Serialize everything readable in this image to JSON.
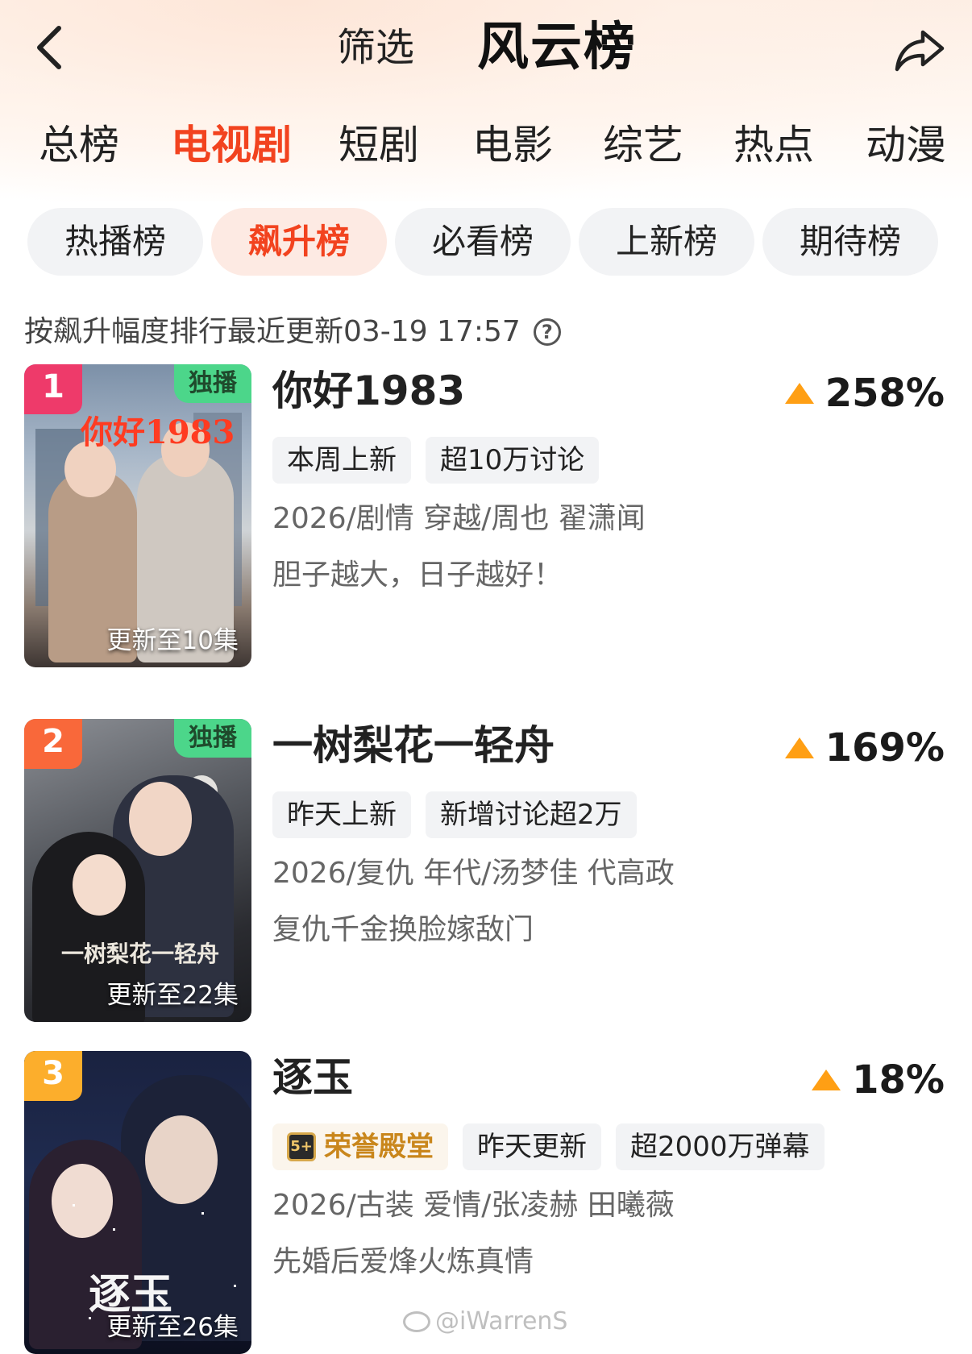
{
  "header": {
    "filter_label": "筛选",
    "title": "风云榜"
  },
  "category_tabs": [
    "总榜",
    "电视剧",
    "短剧",
    "电影",
    "综艺",
    "热点",
    "动漫"
  ],
  "active_category": "电视剧",
  "sub_tabs": [
    "热播榜",
    "飙升榜",
    "必看榜",
    "上新榜",
    "期待榜"
  ],
  "active_sub_tab": "飙升榜",
  "info_line": "按飙升幅度排行最近更新03-19 17:57",
  "items": [
    {
      "rank": "1",
      "title": "你好1983",
      "rise": "258%",
      "exclusive": "独播",
      "episodes": "更新至10集",
      "poster_logo": "你好1983",
      "tags": [
        "本周上新",
        "超10万讨论"
      ],
      "meta": "2026/剧情 穿越/周也 翟潇闻",
      "desc": "胆子越大，日子越好！"
    },
    {
      "rank": "2",
      "title": "一树梨花一轻舟",
      "rise": "169%",
      "exclusive": "独播",
      "episodes": "更新至22集",
      "poster_logo": "一树梨花一轻舟",
      "tags": [
        "昨天上新",
        "新增讨论超2万"
      ],
      "meta": "2026/复仇 年代/汤梦佳 代高政",
      "desc": "复仇千金换脸嫁敌门"
    },
    {
      "rank": "3",
      "title": "逐玉",
      "rise": "18%",
      "episodes": "更新至26集",
      "poster_logo": "逐玉",
      "honor_tag": "荣誉殿堂",
      "honor_icon_text": "5+",
      "tags": [
        "昨天更新",
        "超2000万弹幕"
      ],
      "meta": "2026/古装 爱情/张凌赫 田曦薇",
      "desc": "先婚后爱烽火炼真情"
    }
  ],
  "watermark": "@iWarrenS",
  "colors": {
    "accent": "#f2431f",
    "rank1": "#ee3a6a",
    "rank2": "#f9683a",
    "rank3": "#fcae2c",
    "rise_arrow": "#ff9f14",
    "exclusive_bg": "#4cd68a",
    "honor_text": "#c9861b"
  },
  "icons": {
    "back": "chevron-left-icon",
    "share": "share-arrow-icon",
    "help": "question-circle-icon",
    "rise": "triangle-up-icon"
  }
}
